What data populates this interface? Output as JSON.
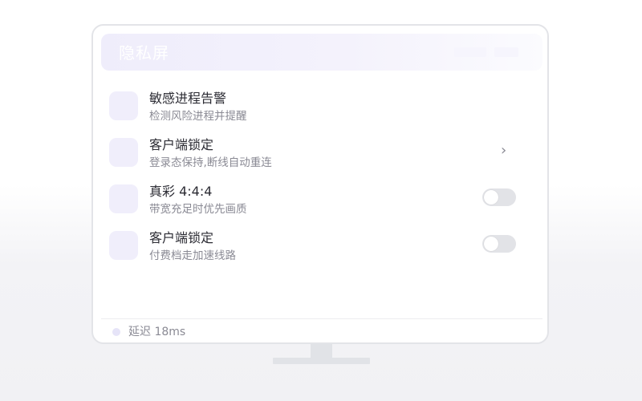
{
  "window": {
    "title": "隐私屏"
  },
  "settings": [
    {
      "title": "敏感进程告警",
      "subtitle": "检测风险进程并提醒",
      "control": "none"
    },
    {
      "title": "客户端锁定",
      "subtitle": "登录态保持,断线自动重连",
      "control": "chevron",
      "chevron_glyph": "›"
    },
    {
      "title": "真彩 4:4:4",
      "subtitle": "带宽充足时优先画质",
      "control": "toggle",
      "toggle_on": false
    },
    {
      "title": "客户端锁定",
      "subtitle": "付费档走加速线路",
      "control": "toggle",
      "toggle_on": false
    }
  ],
  "status": {
    "text": "延迟 18ms"
  },
  "colors": {
    "accent_tint": "#f0eefb",
    "text_primary": "#2b2b33",
    "text_secondary": "#8a8a94",
    "toggle_off": "#e2e3e7",
    "status_dot": "#e6e4f8"
  },
  "icons": {
    "row_icon": "placeholder-square-icon",
    "chevron": "chevron-right-icon",
    "status": "status-dot-icon"
  }
}
